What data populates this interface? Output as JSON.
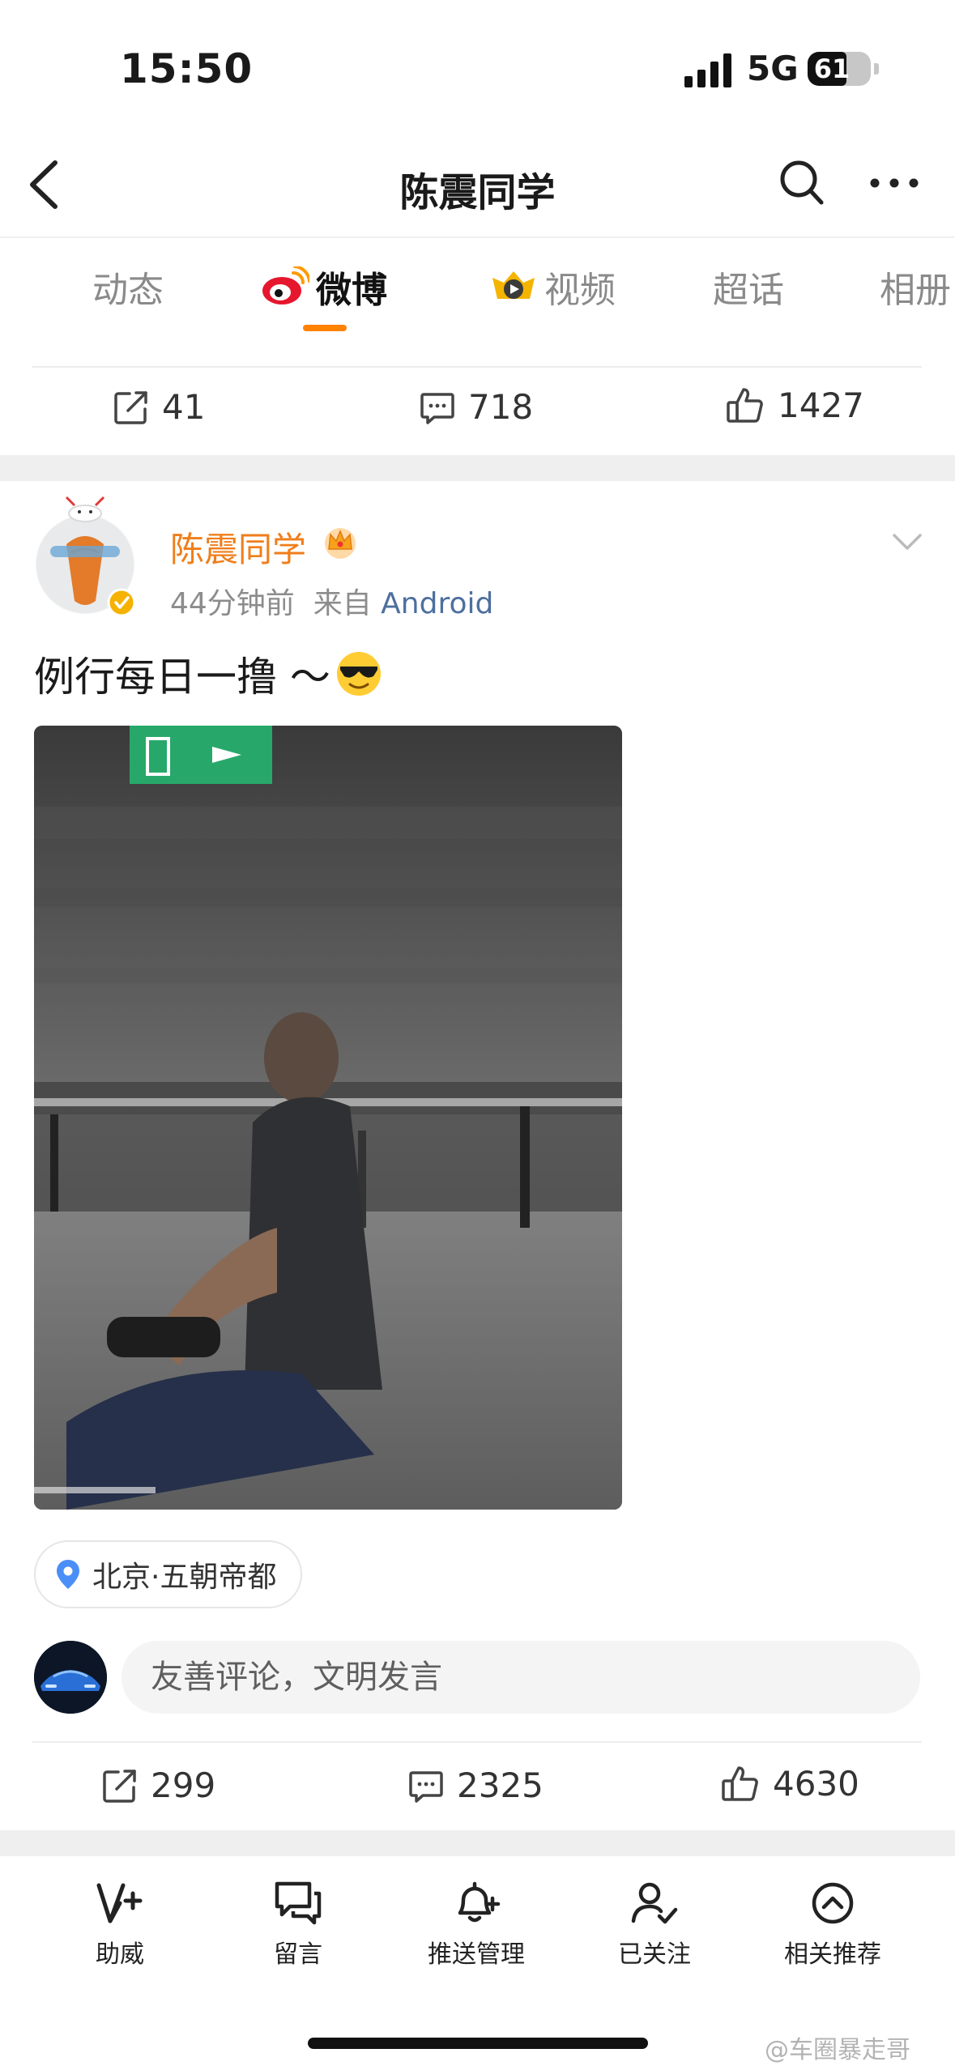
{
  "status_bar": {
    "time": "15:50",
    "network": "5G",
    "battery": "61",
    "battery_fraction": 0.61
  },
  "nav": {
    "title": "陈震同学"
  },
  "tabs": [
    {
      "label": "动态",
      "active": false
    },
    {
      "label": "微博",
      "active": true
    },
    {
      "label": "视频",
      "active": false
    },
    {
      "label": "超话",
      "active": false
    },
    {
      "label": "相册",
      "active": false
    }
  ],
  "prev_post_actions": {
    "reposts": "41",
    "comments": "718",
    "likes": "1427"
  },
  "post": {
    "author": "陈震同学",
    "time_ago": "44分钟前",
    "source_prefix": "来自",
    "source": "Android",
    "text": "例行每日一撸 ～",
    "location": "北京·五朝帝都",
    "comment_placeholder": "友善评论，文明发言",
    "actions": {
      "reposts": "299",
      "comments": "2325",
      "likes": "4630"
    }
  },
  "toolbar": [
    {
      "label": "助威",
      "icon": "cheer-icon"
    },
    {
      "label": "留言",
      "icon": "message-icon"
    },
    {
      "label": "推送管理",
      "icon": "bell-plus-icon"
    },
    {
      "label": "已关注",
      "icon": "user-check-icon"
    },
    {
      "label": "相关推荐",
      "icon": "circle-up-icon"
    }
  ],
  "watermark": "@车圈暴走哥",
  "colors": {
    "accent": "#ff8200",
    "author": "#f07e1b",
    "source_link": "#4d6f9e"
  }
}
